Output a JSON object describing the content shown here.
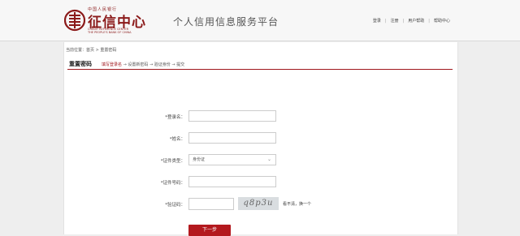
{
  "header": {
    "logo_small": "中国人民银行",
    "logo_big": "征信中心",
    "logo_en_line1": "CREDIT REFERENCE CENTER",
    "logo_en_line2": "THE PEOPLE'S BANK OF CHINA",
    "site_title": "个人信用信息服务平台",
    "nav": [
      "登录",
      "注册",
      "用户帮助",
      "帮助中心"
    ]
  },
  "breadcrumb": "当前位置：首页 > 重置密码",
  "section_title": "重置密码",
  "steps": {
    "active": "填写登录名",
    "rest": " → 设置新密码 → 验证身份 → 提交"
  },
  "form": {
    "login_label": "*登录名：",
    "name_label": "*姓名：",
    "id_type_label": "*证件类型：",
    "id_type_value": "身份证",
    "id_number_label": "*证件号码：",
    "captcha_label": "*验证码：",
    "captcha_text": "q8p3u",
    "captcha_refresh": "看不清，换一个",
    "next_button": "下一步"
  },
  "colors": {
    "accent": "#b3191e",
    "brand": "#8b1a1a"
  }
}
